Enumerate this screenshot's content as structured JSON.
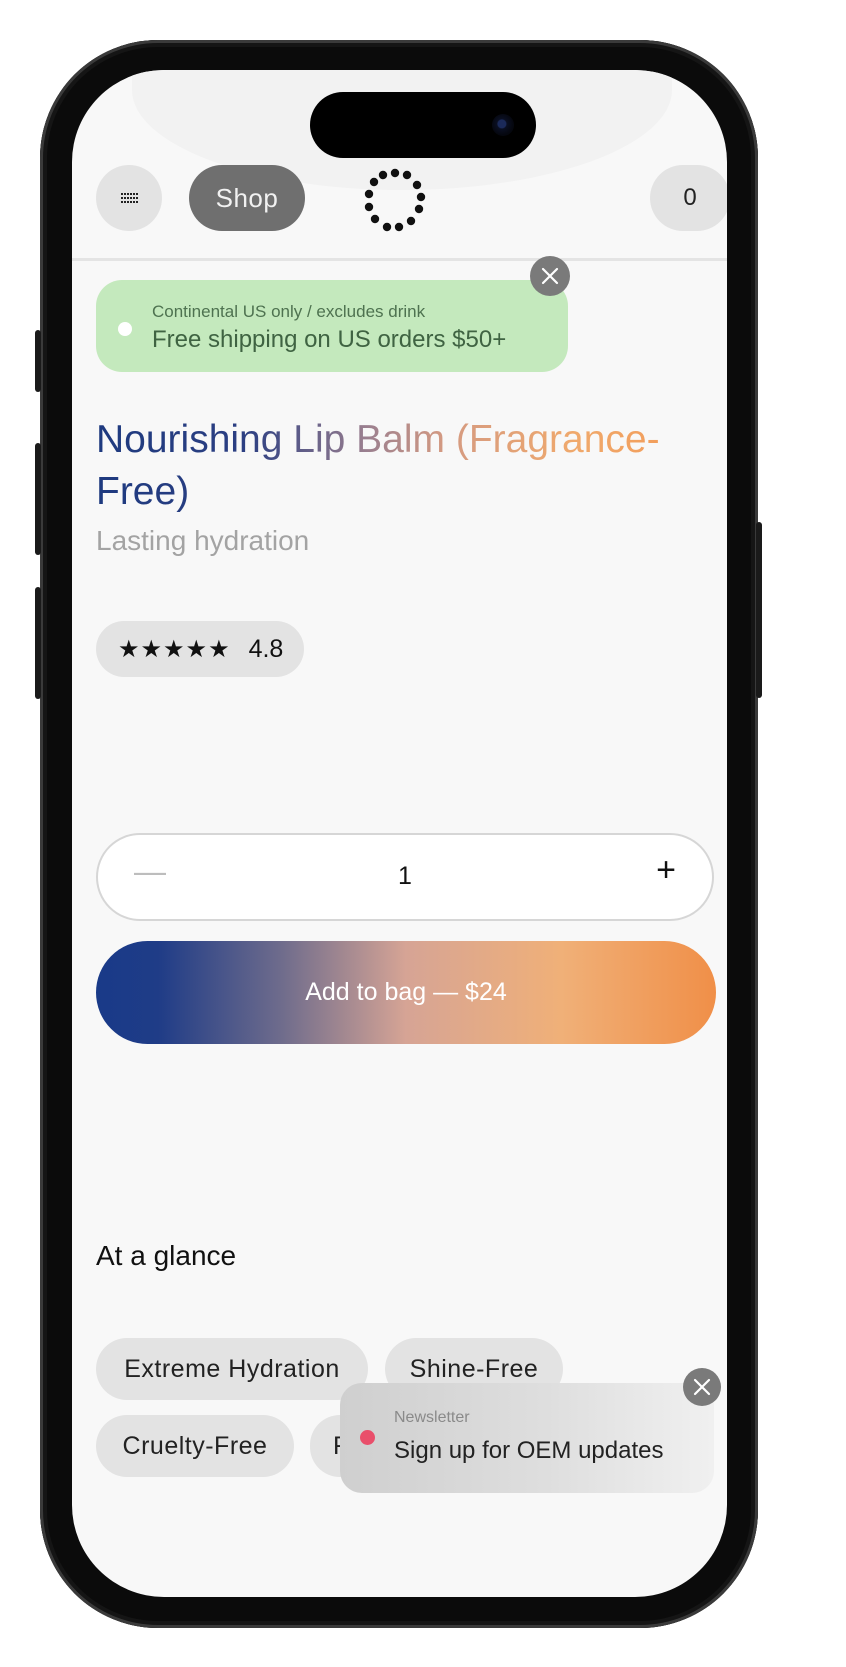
{
  "header": {
    "menu_icon": "menu-icon",
    "shop_label": "Shop",
    "logo_icon": "dotted-circle-logo",
    "cart_count": "0"
  },
  "shipping_banner": {
    "note": "Continental US only / excludes drink",
    "message": "Free shipping on US orders $50+"
  },
  "product": {
    "title": "Nourishing Lip Balm (Fragrance-Free)",
    "subtitle": "Lasting hydration",
    "rating_stars": "★★★★★",
    "rating_value": "4.8",
    "quantity": "1",
    "add_to_bag": "Add to bag — $24"
  },
  "glance": {
    "heading": "At a glance",
    "chips": [
      "Extreme Hydration",
      "Shine-Free",
      "Cruelty-Free",
      "F"
    ]
  },
  "newsletter": {
    "label": "Newsletter",
    "message": "Sign up for OEM updates"
  },
  "colors": {
    "banner_bg": "#c4e9bd",
    "add_gradient_start": "#193a88",
    "add_gradient_end": "#f08f48",
    "newsletter_dot": "#e94f6b"
  }
}
